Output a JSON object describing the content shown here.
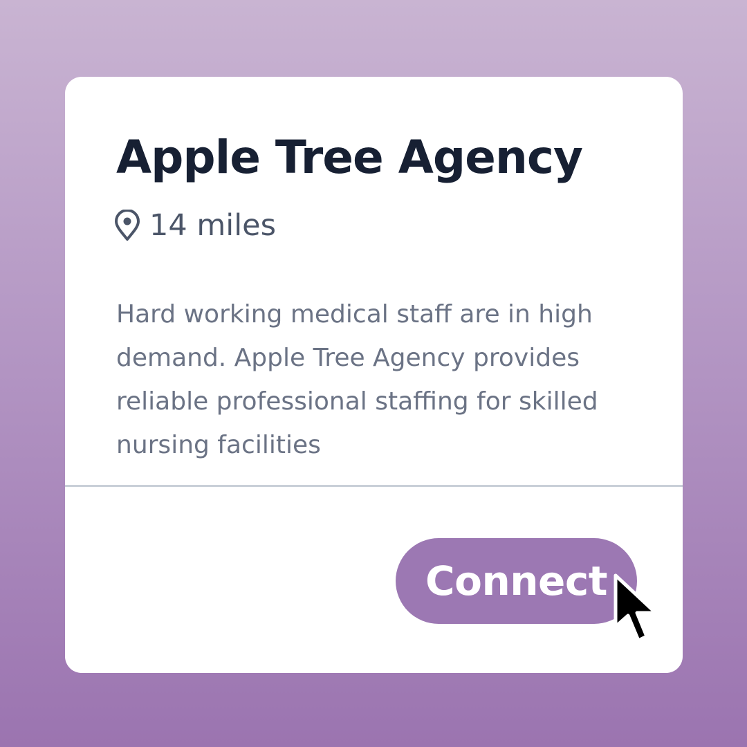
{
  "card": {
    "title": "Apple Tree Agency",
    "distance": {
      "icon": "map-pin-icon",
      "text": "14 miles"
    },
    "description": "Hard working medical staff are in high demand. Apple Tree Agency provides reliable professional staffing for skilled nursing facilities",
    "connect_label": "Connect"
  },
  "cursor": {
    "icon": "mouse-pointer-icon"
  },
  "colors": {
    "background_top": "#c9b4d2",
    "background_bottom": "#9b74b0",
    "card": "#ffffff",
    "title": "#172033",
    "muted_text": "#6b7385",
    "button": "#9c78b3",
    "button_text": "#ffffff"
  }
}
